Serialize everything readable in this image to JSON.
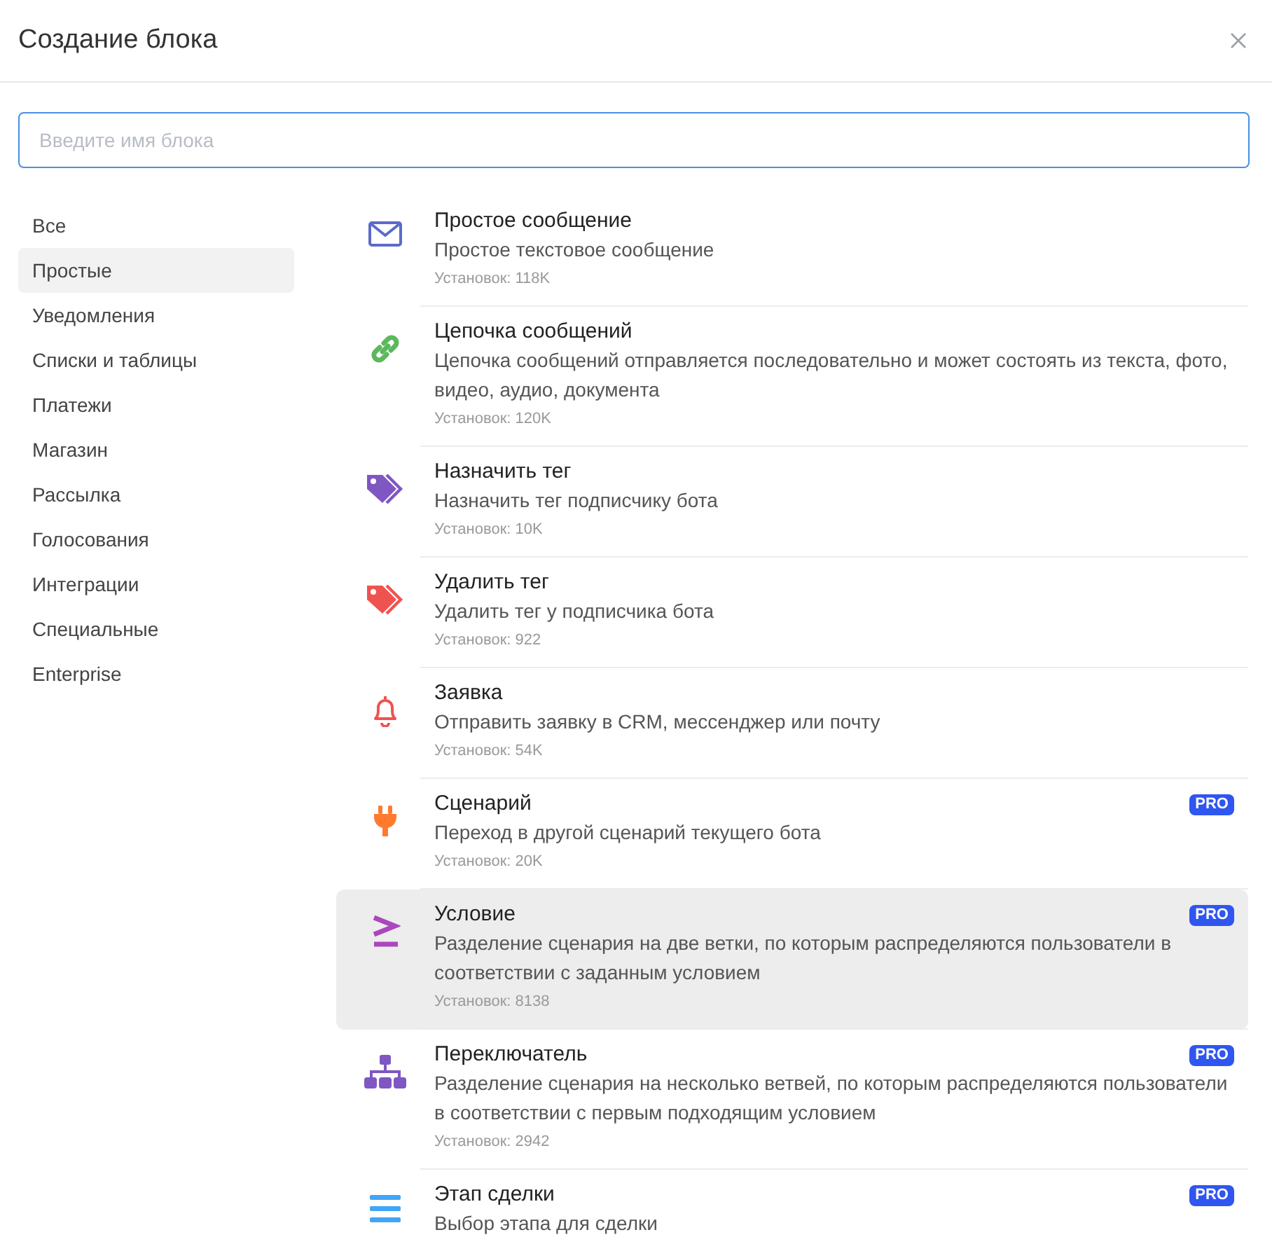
{
  "dialog": {
    "title": "Создание блока"
  },
  "search": {
    "placeholder": "Введите имя блока"
  },
  "categories": [
    {
      "label": "Все",
      "selected": false
    },
    {
      "label": "Простые",
      "selected": true
    },
    {
      "label": "Уведомления",
      "selected": false
    },
    {
      "label": "Списки и таблицы",
      "selected": false
    },
    {
      "label": "Платежи",
      "selected": false
    },
    {
      "label": "Магазин",
      "selected": false
    },
    {
      "label": "Рассылка",
      "selected": false
    },
    {
      "label": "Голосования",
      "selected": false
    },
    {
      "label": "Интеграции",
      "selected": false
    },
    {
      "label": "Специальные",
      "selected": false
    },
    {
      "label": "Enterprise",
      "selected": false
    }
  ],
  "blocks": [
    {
      "kind": "envelope",
      "color": "#5b6bc9",
      "title": "Простое сообщение",
      "description": "Простое текстовое сообщение",
      "installs": "Установок: 118K",
      "selected": false
    },
    {
      "kind": "link",
      "color": "#5cb85c",
      "title": "Цепочка сообщений",
      "description": "Цепочка сообщений отправляется последовательно и может состоять из текста, фото, видео, аудио, документа",
      "installs": "Установок: 120K",
      "selected": false
    },
    {
      "kind": "tags",
      "color": "#7e57c2",
      "title": "Назначить тег",
      "description": "Назначить тег подписчику бота",
      "installs": "Установок: 10K",
      "selected": false
    },
    {
      "kind": "tags",
      "color": "#ef5350",
      "title": "Удалить тег",
      "description": "Удалить тег у подписчика бота",
      "installs": "Установок: 922",
      "selected": false
    },
    {
      "kind": "bell",
      "color": "#ef5350",
      "title": "Заявка",
      "description": "Отправить заявку в CRM, мессенджер или почту",
      "installs": "Установок: 54K",
      "selected": false
    },
    {
      "kind": "plug",
      "color": "#ff7a2f",
      "title": "Сценарий",
      "description": "Переход в другой сценарий текущего бота",
      "installs": "Установок: 20K",
      "badge": "PRO",
      "selected": false
    },
    {
      "kind": "condition",
      "color": "#ab47bc",
      "title": "Условие",
      "description": "Разделение сценария на две ветки, по которым распределяются пользователи в соответствии с заданным условием",
      "installs": "Установок: 8138",
      "badge": "PRO",
      "selected": true
    },
    {
      "kind": "sitemap",
      "color": "#7e57c2",
      "title": "Переключатель",
      "description": "Разделение сценария на несколько ветвей, по которым распределяются пользователи в соответствии с первым подходящим условием",
      "installs": "Установок: 2942",
      "badge": "PRO",
      "selected": false
    },
    {
      "kind": "bars",
      "color": "#42a5f5",
      "title": "Этап сделки",
      "description": "Выбор этапа для сделки",
      "badge": "PRO",
      "selected": false
    }
  ]
}
